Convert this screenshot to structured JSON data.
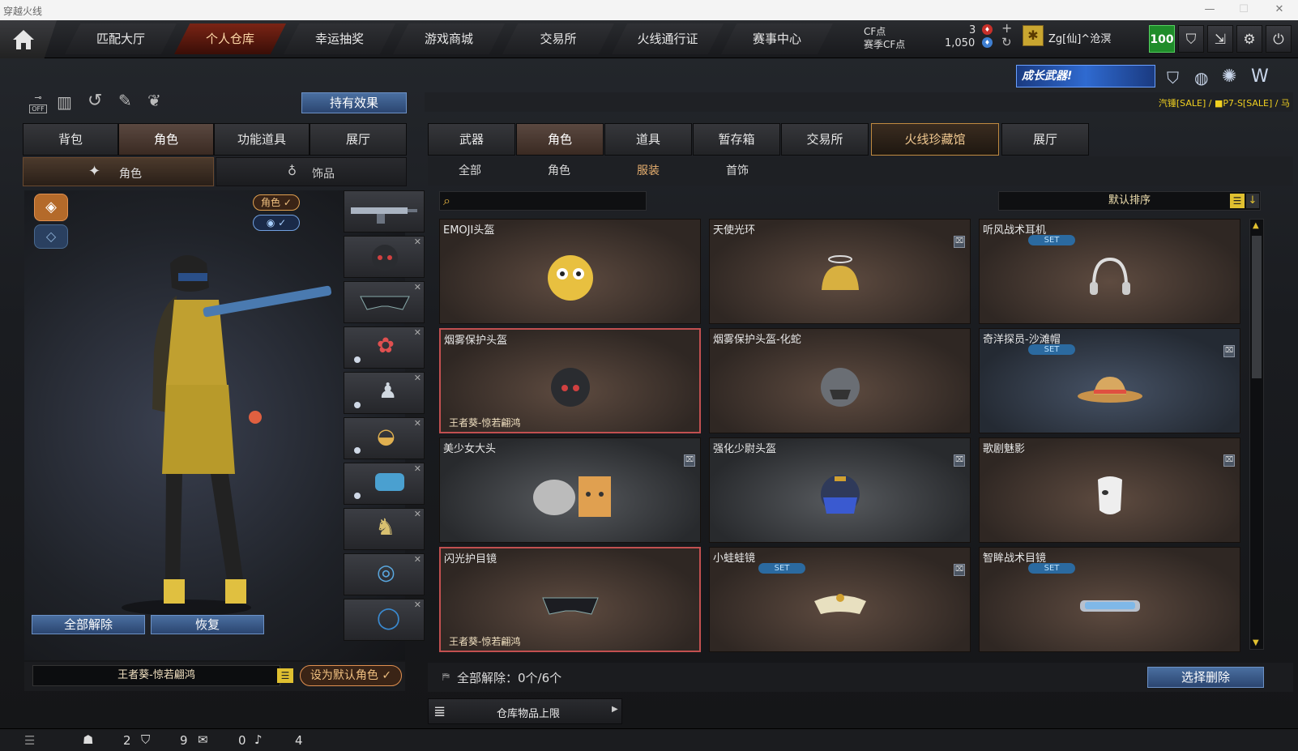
{
  "window": {
    "title": "穿越火线"
  },
  "nav": {
    "tabs": [
      "匹配大厅",
      "个人仓库",
      "幸运抽奖",
      "游戏商城",
      "交易所",
      "火线通行证",
      "赛事中心"
    ],
    "active_index": 1
  },
  "currency": {
    "cf_label": "CF点",
    "season_label": "赛季CF点",
    "cf_value": "3",
    "season_value": "1,050"
  },
  "user": {
    "name": "Zg[仙]^沧溟",
    "level": "100"
  },
  "promo": {
    "banner": "成长武器!",
    "ticker": "汽锤[SALE] / ■P7-S[SALE] / 马"
  },
  "left": {
    "hold_effect": "持有效果",
    "tabs": [
      "背包",
      "角色",
      "功能道具",
      "展厅"
    ],
    "subtabs": [
      "角色",
      "饰品"
    ],
    "role_tag": "角色",
    "release_all": "全部解除",
    "restore": "恢复",
    "character_name": "王者葵-惊若翩鸿",
    "set_default": "设为默认角色"
  },
  "right": {
    "tabs": [
      "武器",
      "角色",
      "道具",
      "暂存箱",
      "交易所",
      "火线珍藏馆",
      "展厅"
    ],
    "subtabs": [
      "全部",
      "角色",
      "服装",
      "首饰"
    ],
    "active_subtab": 2,
    "search_placeholder": "",
    "sort_label": "默认排序",
    "items": [
      {
        "name": "EMOJI头盔",
        "set": "",
        "owner": "",
        "lock": false,
        "selected": false,
        "tone": "brown"
      },
      {
        "name": "天使光环",
        "set": "",
        "owner": "",
        "lock": true,
        "selected": false,
        "tone": "brown"
      },
      {
        "name": "听风战术耳机",
        "set": "SET",
        "owner": "",
        "lock": false,
        "selected": false,
        "tone": "brown"
      },
      {
        "name": "烟雾保护头盔",
        "set": "",
        "owner": "王者葵-惊若翩鸿",
        "lock": false,
        "selected": true,
        "tone": "brown"
      },
      {
        "name": "烟雾保护头盔-化蛇",
        "set": "",
        "owner": "",
        "lock": false,
        "selected": false,
        "tone": "brown"
      },
      {
        "name": "奇洋探员-沙滩帽",
        "set": "SET",
        "owner": "",
        "lock": true,
        "selected": false,
        "tone": "blue"
      },
      {
        "name": "美少女大头",
        "set": "",
        "owner": "",
        "lock": true,
        "selected": false,
        "tone": "grey"
      },
      {
        "name": "强化少尉头盔",
        "set": "",
        "owner": "",
        "lock": true,
        "selected": false,
        "tone": "grey"
      },
      {
        "name": "歌剧魅影",
        "set": "",
        "owner": "",
        "lock": true,
        "selected": false,
        "tone": "brown"
      },
      {
        "name": "闪光护目镜",
        "set": "",
        "owner": "王者葵-惊若翩鸿",
        "lock": false,
        "selected": true,
        "tone": "brown"
      },
      {
        "name": "小蛙蛙镜",
        "set": "SET",
        "owner": "",
        "lock": true,
        "selected": false,
        "tone": "brown"
      },
      {
        "name": "智眸战术目镜",
        "set": "SET",
        "owner": "",
        "lock": false,
        "selected": false,
        "tone": "brown"
      }
    ],
    "release_count_label": "全部解除：0个/6个",
    "select_delete": "选择删除",
    "storage_limit": "仓库物品上限"
  },
  "status": {
    "v1": "2",
    "v2": "9",
    "v3": "0",
    "v4": "4"
  }
}
